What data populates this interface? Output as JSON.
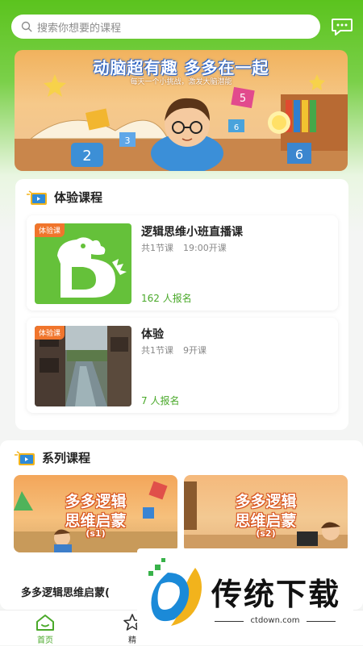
{
  "search": {
    "placeholder": "搜索你想要的课程"
  },
  "banner": {
    "title": "动脑超有趣 多多在一起",
    "subtitle": "每天一个小挑战，激发大脑潜能"
  },
  "trial_section": {
    "title": "体验课程",
    "courses": [
      {
        "tag": "体验课",
        "name": "逻辑思维小班直播课",
        "lessons": "共1节课",
        "time": "19:00开课",
        "enrolled": "162 人报名"
      },
      {
        "tag": "体验课",
        "name": "体验",
        "lessons": "共1节课",
        "time": "9开课",
        "enrolled": "7 人报名"
      }
    ]
  },
  "series_section": {
    "title": "系列课程",
    "cards": [
      {
        "line1": "多多逻辑",
        "line2": "思维启蒙",
        "sub": "(s1)"
      },
      {
        "line1": "多多逻辑",
        "line2": "思维启蒙",
        "sub": "(s2)"
      }
    ],
    "first_name": "多多逻辑思维启蒙("
  },
  "tabbar": {
    "home": "首页",
    "second": "精"
  },
  "watermark": {
    "brand": "传统下载",
    "url": "ctdown.com"
  },
  "colors": {
    "brand_green": "#5bc31e",
    "tag_orange": "#f0752c",
    "enroll_green": "#4aa92a"
  }
}
